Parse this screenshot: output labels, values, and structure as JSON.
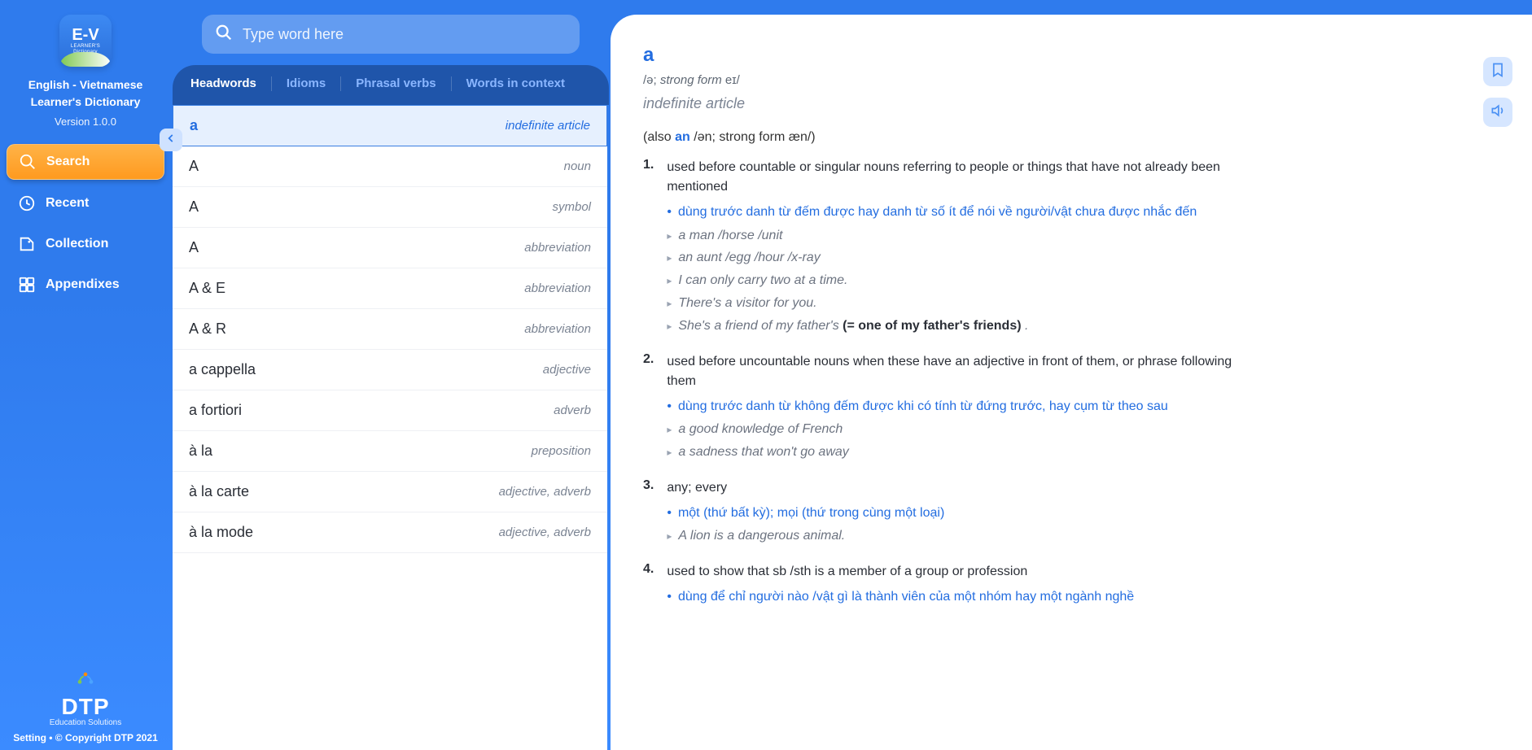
{
  "sidebar": {
    "logo": {
      "text": "E-V",
      "sub": "LEARNER'S",
      "sub2": "Dictionary"
    },
    "title_line1": "English - Vietnamese",
    "title_line2": "Learner's Dictionary",
    "version": "Version 1.0.0",
    "nav": [
      {
        "key": "search",
        "label": "Search",
        "active": true
      },
      {
        "key": "recent",
        "label": "Recent",
        "active": false
      },
      {
        "key": "collection",
        "label": "Collection",
        "active": false
      },
      {
        "key": "appendixes",
        "label": "Appendixes",
        "active": false
      }
    ],
    "brand": {
      "name": "DTP",
      "tag": "Education Solutions"
    },
    "footer": {
      "setting": "Setting",
      "sep": " • ",
      "copyright": "© Copyright DTP 2021"
    }
  },
  "search": {
    "placeholder": "Type word here"
  },
  "tabs": [
    {
      "key": "headwords",
      "label": "Headwords",
      "active": true
    },
    {
      "key": "idioms",
      "label": "Idioms",
      "active": false
    },
    {
      "key": "phrasal",
      "label": "Phrasal verbs",
      "active": false
    },
    {
      "key": "context",
      "label": "Words in context",
      "active": false
    }
  ],
  "words": [
    {
      "word": "a",
      "pos": "indefinite article",
      "selected": true
    },
    {
      "word": "A",
      "pos": "noun",
      "selected": false
    },
    {
      "word": "A",
      "pos": "symbol",
      "selected": false
    },
    {
      "word": "A",
      "pos": "abbreviation",
      "selected": false
    },
    {
      "word": "A & E",
      "pos": "abbreviation",
      "selected": false
    },
    {
      "word": "A & R",
      "pos": "abbreviation",
      "selected": false
    },
    {
      "word": "a cappella",
      "pos": "adjective",
      "selected": false
    },
    {
      "word": "a fortiori",
      "pos": "adverb",
      "selected": false
    },
    {
      "word": "à la",
      "pos": "preposition",
      "selected": false
    },
    {
      "word": "à la carte",
      "pos": "adjective, adverb",
      "selected": false
    },
    {
      "word": "à la mode",
      "pos": "adjective, adverb",
      "selected": false
    }
  ],
  "entry": {
    "headword": "a",
    "pron_prefix": "/ə; ",
    "pron_strong_label": "strong form",
    "pron_suffix": " eɪ/",
    "pos": "indefinite article",
    "also": {
      "prefix": "(also ",
      "alt": "an",
      "rest": " /ən; strong form æn/)"
    },
    "senses": [
      {
        "num": "1.",
        "def_en": "used before countable or singular nouns referring to people or things that have not already been mentioned",
        "def_vi": "dùng trước danh từ đếm được hay danh từ số ít để nói về người/vật chưa được nhắc đến",
        "examples": [
          {
            "text": "a man /horse /unit"
          },
          {
            "text": "an aunt /egg /hour /x-ray"
          },
          {
            "text": "I can only carry two at a time."
          },
          {
            "text": "There's a visitor for you."
          },
          {
            "text": "She's a friend of my father's ",
            "gloss": "(= one of my father's friends)",
            "tail": " ."
          }
        ]
      },
      {
        "num": "2.",
        "def_en": "used before uncountable nouns when these have an adjective in front of them, or phrase following them",
        "def_vi": "dùng trước danh từ không đếm được khi có tính từ đứng trước, hay cụm từ theo sau",
        "examples": [
          {
            "text": "a good knowledge of French"
          },
          {
            "text": "a sadness that won't go away"
          }
        ]
      },
      {
        "num": "3.",
        "def_en": "any; every",
        "def_vi": "một (thứ bất kỳ); mọi (thứ trong cùng một loại)",
        "examples": [
          {
            "text": "A lion is a dangerous animal."
          }
        ]
      },
      {
        "num": "4.",
        "def_en": "used to show that sb /sth is a member of a group or profession",
        "def_vi": "dùng để chỉ người nào /vật gì là thành viên của một nhóm hay một ngành nghề",
        "examples": []
      }
    ]
  }
}
